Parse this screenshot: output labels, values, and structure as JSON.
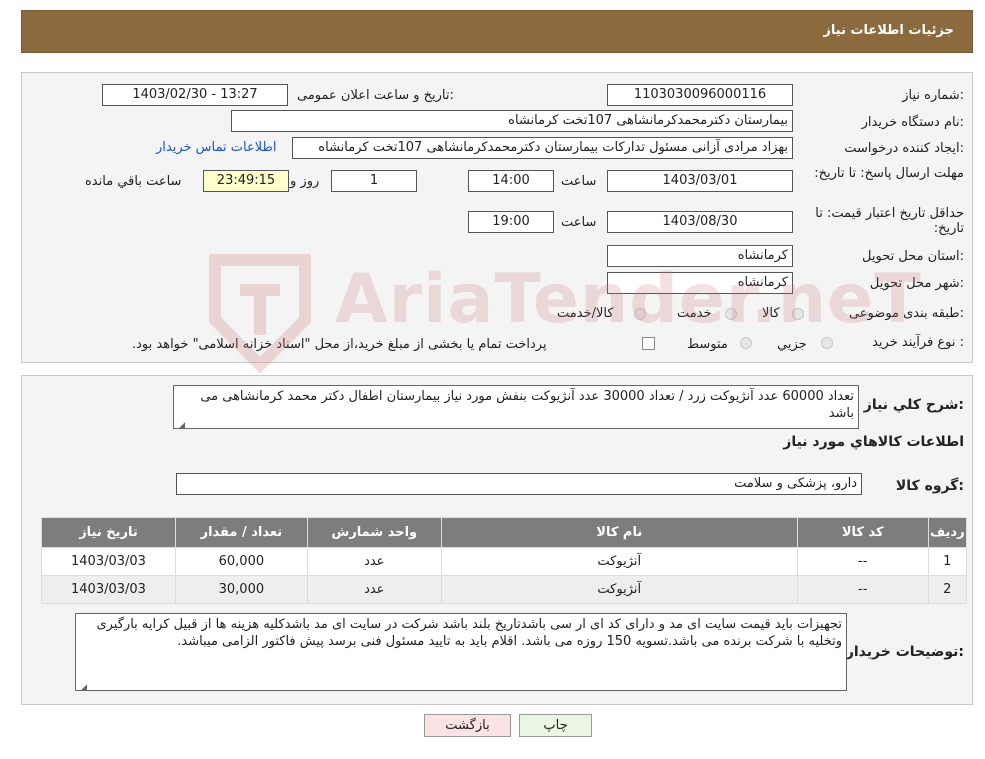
{
  "header": {
    "title": "جزئیات اطلاعات نیاز"
  },
  "form": {
    "need_number_label": "شماره نیاز:",
    "need_number": "1103030096000116",
    "announce_label": "تاریخ و ساعت اعلان عمومی:",
    "announce_value": "1403/02/30 - 13:27",
    "buyer_org_label": "نام دستگاه خریدار:",
    "buyer_org": "بیمارستان دکترمحمدکرمانشاهی 107تخت کرمانشاه",
    "creator_label": "ایجاد کننده درخواست:",
    "creator": "بهزاد مرادی آزانی مسئول تدارکات بیمارستان دکترمحمدکرمانشاهی 107تخت کرمانشاه",
    "contact_link": "اطلاعات تماس خریدار",
    "deadline_label": "مهلت ارسال پاسخ: تا تاریخ:",
    "deadline_date": "1403/03/01",
    "time_label": "ساعت",
    "deadline_time": "14:00",
    "days_value": "1",
    "days_label": "روز و",
    "remaining_time": "23:49:15",
    "remaining_label": "ساعت باقي مانده",
    "validity_label": "حداقل تاریخ اعتبار قیمت: تا تاریخ:",
    "validity_date": "1403/08/30",
    "validity_time": "19:00",
    "province_label": "استان محل تحویل:",
    "province": "کرمانشاه",
    "city_label": "شهر محل تحویل:",
    "city": "کرمانشاه",
    "category_label": "طبقه بندی موضوعی:",
    "category_options": [
      "کالا",
      "خدمت",
      "کالا/خدمت"
    ],
    "purchase_type_label": "نوع فرآیند خرید :",
    "purchase_options": [
      "جزیي",
      "متوسط"
    ],
    "payment_note": "پرداخت تمام یا بخشی از مبلغ خرید،از محل \"اسناد خزانه اسلامی\" خواهد بود."
  },
  "watermark": {
    "text": "AriaTender.neT"
  },
  "details": {
    "description_label": "شرح کلي نياز:",
    "description": "تعداد  60000 عدد آنژیوکت زرد / تعداد 30000 عدد آنژیوکت بنفش  مورد نیاز بیمارستان اطفال دکتر محمد کرمانشاهی می باشد",
    "goods_info_title": "اطلاعات کالاهاي مورد نياز",
    "group_label": "گروه کالا:",
    "group_value": "دارو، پزشکی و سلامت",
    "table": {
      "headers": [
        "رديف",
        "کد کالا",
        "نام کالا",
        "واحد شمارش",
        "تعداد / مقدار",
        "تاريخ نياز"
      ],
      "rows": [
        [
          "1",
          "--",
          "آنژیوکت",
          "عدد",
          "60,000",
          "1403/03/03"
        ],
        [
          "2",
          "--",
          "آنژیوکت",
          "عدد",
          "30,000",
          "1403/03/03"
        ]
      ]
    },
    "buyer_notes_label": "توضیحات خریدار:",
    "buyer_notes": "تجهیزات باید قیمت سایت ای مد و دارای کد ای ار سی باشدتاریخ بلند باشد شرکت در سایت ای مد باشدکلیه هزینه ها از قبیل کرایه بارگیری وتخلیه با شرکت برنده می باشد.تسویه 150 روزه می باشد. اقلام باید به تایید مسئول فنی برسد پیش فاکتور الزامی میباشد."
  },
  "buttons": {
    "print": "چاپ",
    "back": "بازگشت"
  }
}
